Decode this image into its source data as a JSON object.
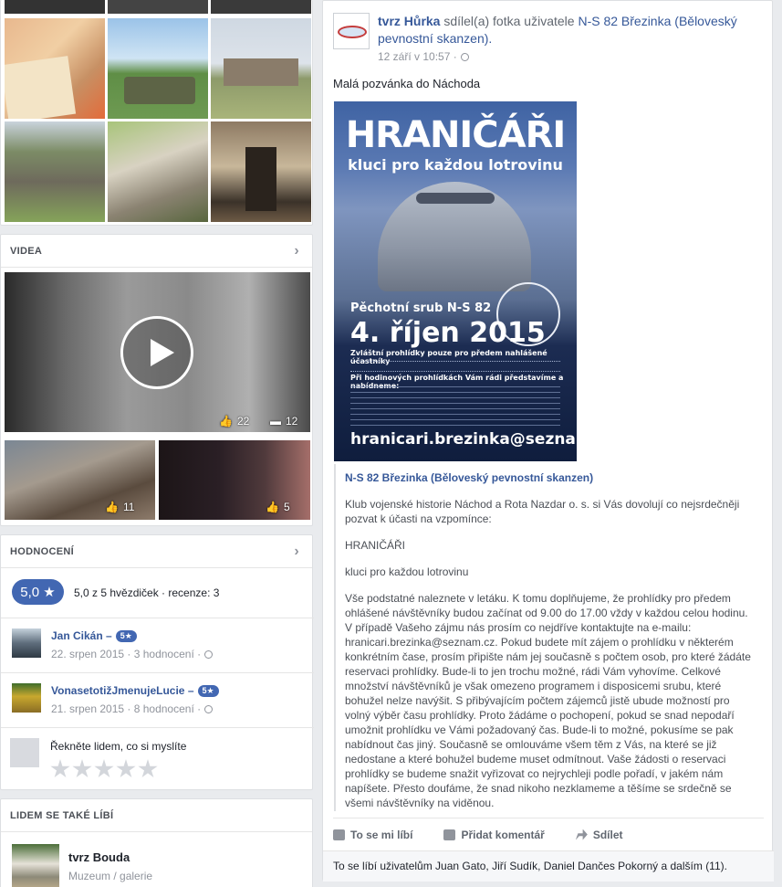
{
  "videos": {
    "title": "VIDEA",
    "main": {
      "likes": "22",
      "comments": "12"
    },
    "small": [
      {
        "likes": "11"
      },
      {
        "likes": "5"
      }
    ]
  },
  "ratings": {
    "title": "HODNOCENÍ",
    "score": "5,0 ★",
    "summary": "5,0 z 5 hvězdiček · recenze: 3",
    "reviews": [
      {
        "name": "Jan Cikán –",
        "stars": "5★",
        "meta": "22. srpen 2015 · 3 hodnocení ·"
      },
      {
        "name": "VonasetotižJmenujeLucie –",
        "stars": "5★",
        "meta": "21. srpen 2015 · 8 hodnocení ·"
      }
    ],
    "prompt": "Řekněte lidem, co si myslíte"
  },
  "also_liked": {
    "title": "LIDEM SE TAKÉ LÍBÍ",
    "page_name": "tvrz Bouda",
    "page_category": "Muzeum / galerie"
  },
  "post": {
    "author": "tvrz Hůrka",
    "shared_text": "sdílel(a) fotka",
    "user_text": "uživatele",
    "shared_page": "N-S 82 Březinka",
    "shared_page_rest": "(Běloveský pevnostní skanzen).",
    "timestamp": "12 září v 10:57 ·",
    "text": "Malá pozvánka do Náchoda",
    "poster": {
      "title": "HRANIČÁŘI",
      "subtitle": "kluci pro každou lotrovinu",
      "line1": "Pěchotní srub N-S 82",
      "date": "4. říjen 2015",
      "line2": "Zvláštní prohlídky pouze pro předem nahlášené účastníky",
      "line3": "Při hodinových prohlídkách Vám rádi představíme a nabídneme:",
      "email": "hranicari.brezinka@seznam.cz"
    },
    "shared_block": {
      "name": "N-S 82 Březinka (Běloveský pevnostní skanzen)",
      "p1": "Klub vojenské historie Náchod a Rota Nazdar o. s. si Vás dovolují co nejsrdečněji pozvat k účasti na vzpomínce:",
      "p2": "HRANIČÁŘI",
      "p3": "kluci pro každou lotrovinu",
      "p4": "Vše podstatné naleznete v letáku. K tomu doplňujeme, že prohlídky pro předem ohlášené návštěvníky budou začínat od 9.00 do 17.00 vždy v každou celou hodinu. V případě Vašeho zájmu nás prosím co nejdříve kontaktujte na e-mailu: hranicari.brezinka@seznam.cz. Pokud budete mít zájem o prohlídku v některém konkrétním čase, prosím připište nám jej současně s počtem osob, pro které žádáte reservaci prohlídky. Bude-li to jen trochu možné, rádi Vám vyhovíme. Celkové množství návštěvníků je však omezeno programem i disposicemi srubu, které bohužel nelze navýšit. S přibývajícím počtem zájemců jistě ubude možností pro volný výběr času prohlídky. Proto žádáme o pochopení, pokud se snad nepodaří umožnit prohlídku ve Vámi požadovaný čas. Bude-li to možné, pokusíme se pak nabídnout čas jiný. Současně se omlouváme všem těm z Vás, na které se již nedostane a které bohužel budeme muset odmítnout. Vaše žádosti o reservaci prohlídky se budeme snažit vyřizovat co nejrychleji podle pořadí, v jakém nám napíšete. Přesto doufáme, že snad nikoho nezklameme a těšíme se srdečně se všemi návštěvníky na viděnou."
    },
    "actions": {
      "like": "To se mi líbí",
      "comment": "Přidat komentář",
      "share": "Sdílet"
    },
    "likes_footer": "To se líbí uživatelům Juan Gato, Jiří Sudík, Daniel Dančes Pokorný a dalším (11)."
  }
}
